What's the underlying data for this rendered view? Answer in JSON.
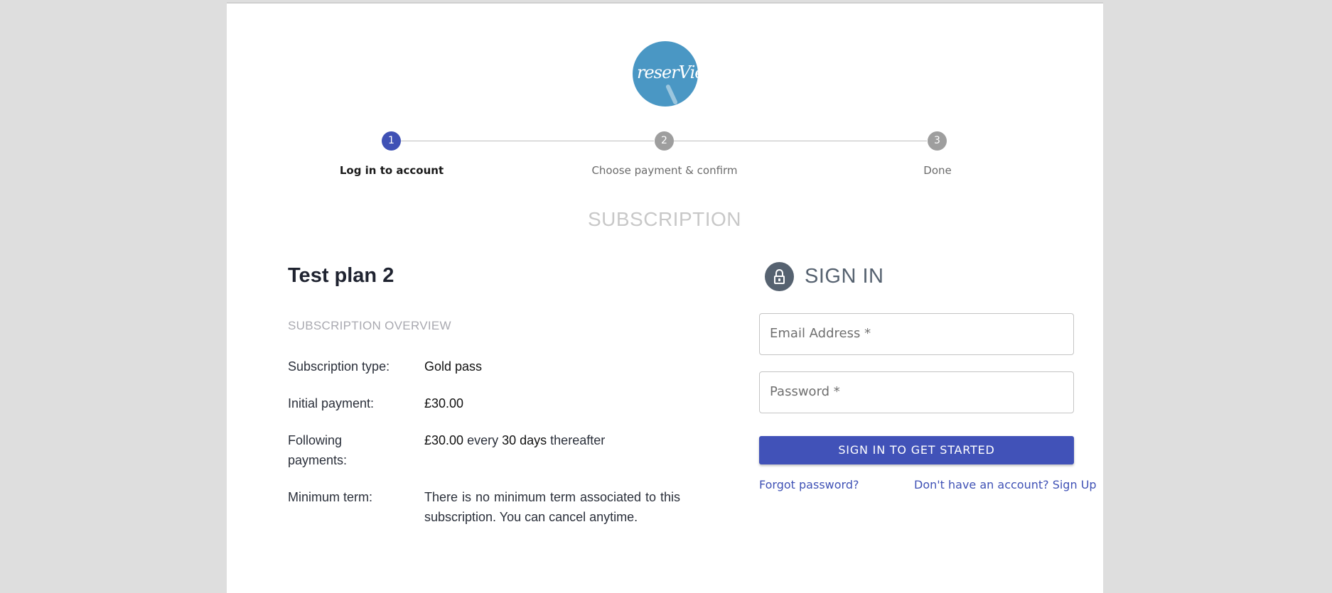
{
  "logo": {
    "text": "reserVie"
  },
  "stepper": {
    "steps": [
      {
        "number": "1",
        "label": "Log in to account",
        "active": true
      },
      {
        "number": "2",
        "label": "Choose payment & confirm",
        "active": false
      },
      {
        "number": "3",
        "label": "Done",
        "active": false
      }
    ],
    "active_color": "#3f51b5",
    "inactive_color": "#9e9e9e"
  },
  "page": {
    "section_title": "SUBSCRIPTION"
  },
  "plan": {
    "title": "Test plan 2",
    "overview_heading": "SUBSCRIPTION OVERVIEW",
    "rows": [
      {
        "label": "Subscription type:",
        "value": "Gold pass"
      },
      {
        "label": "Initial payment:",
        "value": "£30.00"
      },
      {
        "label": "Following payments:",
        "amount": "£30.00",
        "word_every": "every",
        "period": "30 days",
        "word_after": "thereafter"
      },
      {
        "label": "Minimum term:",
        "value": "There is no minimum term associated to this subscription. You can cancel anytime."
      }
    ]
  },
  "signin": {
    "icon": "lock-icon",
    "title": "SIGN IN",
    "email_label": "Email Address *",
    "password_label": "Password *",
    "submit_label": "SIGN IN TO GET STARTED",
    "forgot_label": "Forgot password?",
    "signup_label": "Don't have an account? Sign Up",
    "accent_color": "#3f51b5"
  }
}
